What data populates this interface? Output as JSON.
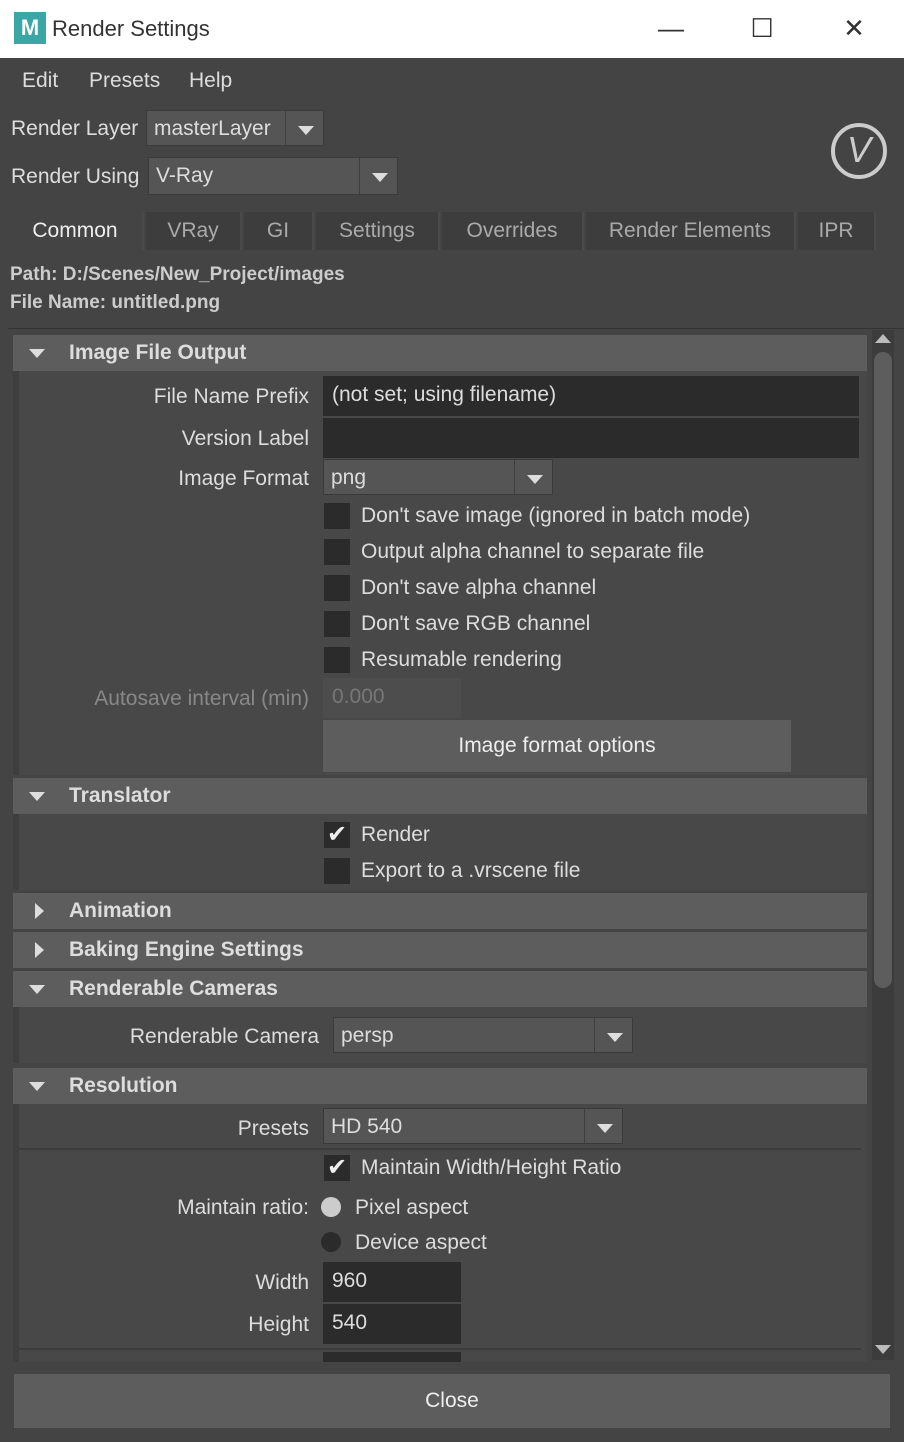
{
  "window": {
    "title": "Render Settings",
    "app_icon": "maya-icon",
    "minimize_glyph": "—",
    "maximize_glyph": "☐",
    "close_glyph": "✕"
  },
  "menu": [
    "Edit",
    "Presets",
    "Help"
  ],
  "render_layer": {
    "label": "Render Layer",
    "value": "masterLayer"
  },
  "render_using": {
    "label": "Render Using",
    "value": "V-Ray"
  },
  "vray_logo_glyph": "V",
  "tabs": [
    "Common",
    "VRay",
    "GI",
    "Settings",
    "Overrides",
    "Render Elements",
    "IPR"
  ],
  "active_tab": "Common",
  "path": "Path: D:/Scenes/New_Project/images",
  "file_name": "File Name: untitled.png",
  "image_file_output": {
    "header": "Image File Output",
    "file_name_prefix_label": "File Name Prefix",
    "file_name_prefix_value": "(not set; using filename)",
    "version_label_label": "Version Label",
    "version_label_value": "",
    "image_format_label": "Image Format",
    "image_format_value": "png",
    "checkboxes": [
      {
        "label": "Don't save image (ignored in batch mode)",
        "checked": false
      },
      {
        "label": "Output alpha channel to separate file",
        "checked": false
      },
      {
        "label": "Don't save alpha channel",
        "checked": false
      },
      {
        "label": "Don't save RGB channel",
        "checked": false
      },
      {
        "label": "Resumable rendering",
        "checked": false
      }
    ],
    "autosave_label": "Autosave interval (min)",
    "autosave_value": "0.000",
    "format_options_button": "Image format options"
  },
  "translator": {
    "header": "Translator",
    "render_label": "Render",
    "render_checked": true,
    "export_label": "Export to a .vrscene file",
    "export_checked": false
  },
  "animation": {
    "header": "Animation"
  },
  "baking": {
    "header": "Baking Engine Settings"
  },
  "cameras": {
    "header": "Renderable Cameras",
    "camera_label": "Renderable Camera",
    "camera_value": "persp"
  },
  "resolution": {
    "header": "Resolution",
    "presets_label": "Presets",
    "presets_value": "HD 540",
    "maintain_wh_label": "Maintain Width/Height Ratio",
    "maintain_wh_checked": true,
    "maintain_ratio_label": "Maintain ratio:",
    "pixel_aspect_label": "Pixel aspect",
    "device_aspect_label": "Device aspect",
    "width_label": "Width",
    "width_value": "960",
    "height_label": "Height",
    "height_value": "540"
  },
  "close_button": "Close"
}
